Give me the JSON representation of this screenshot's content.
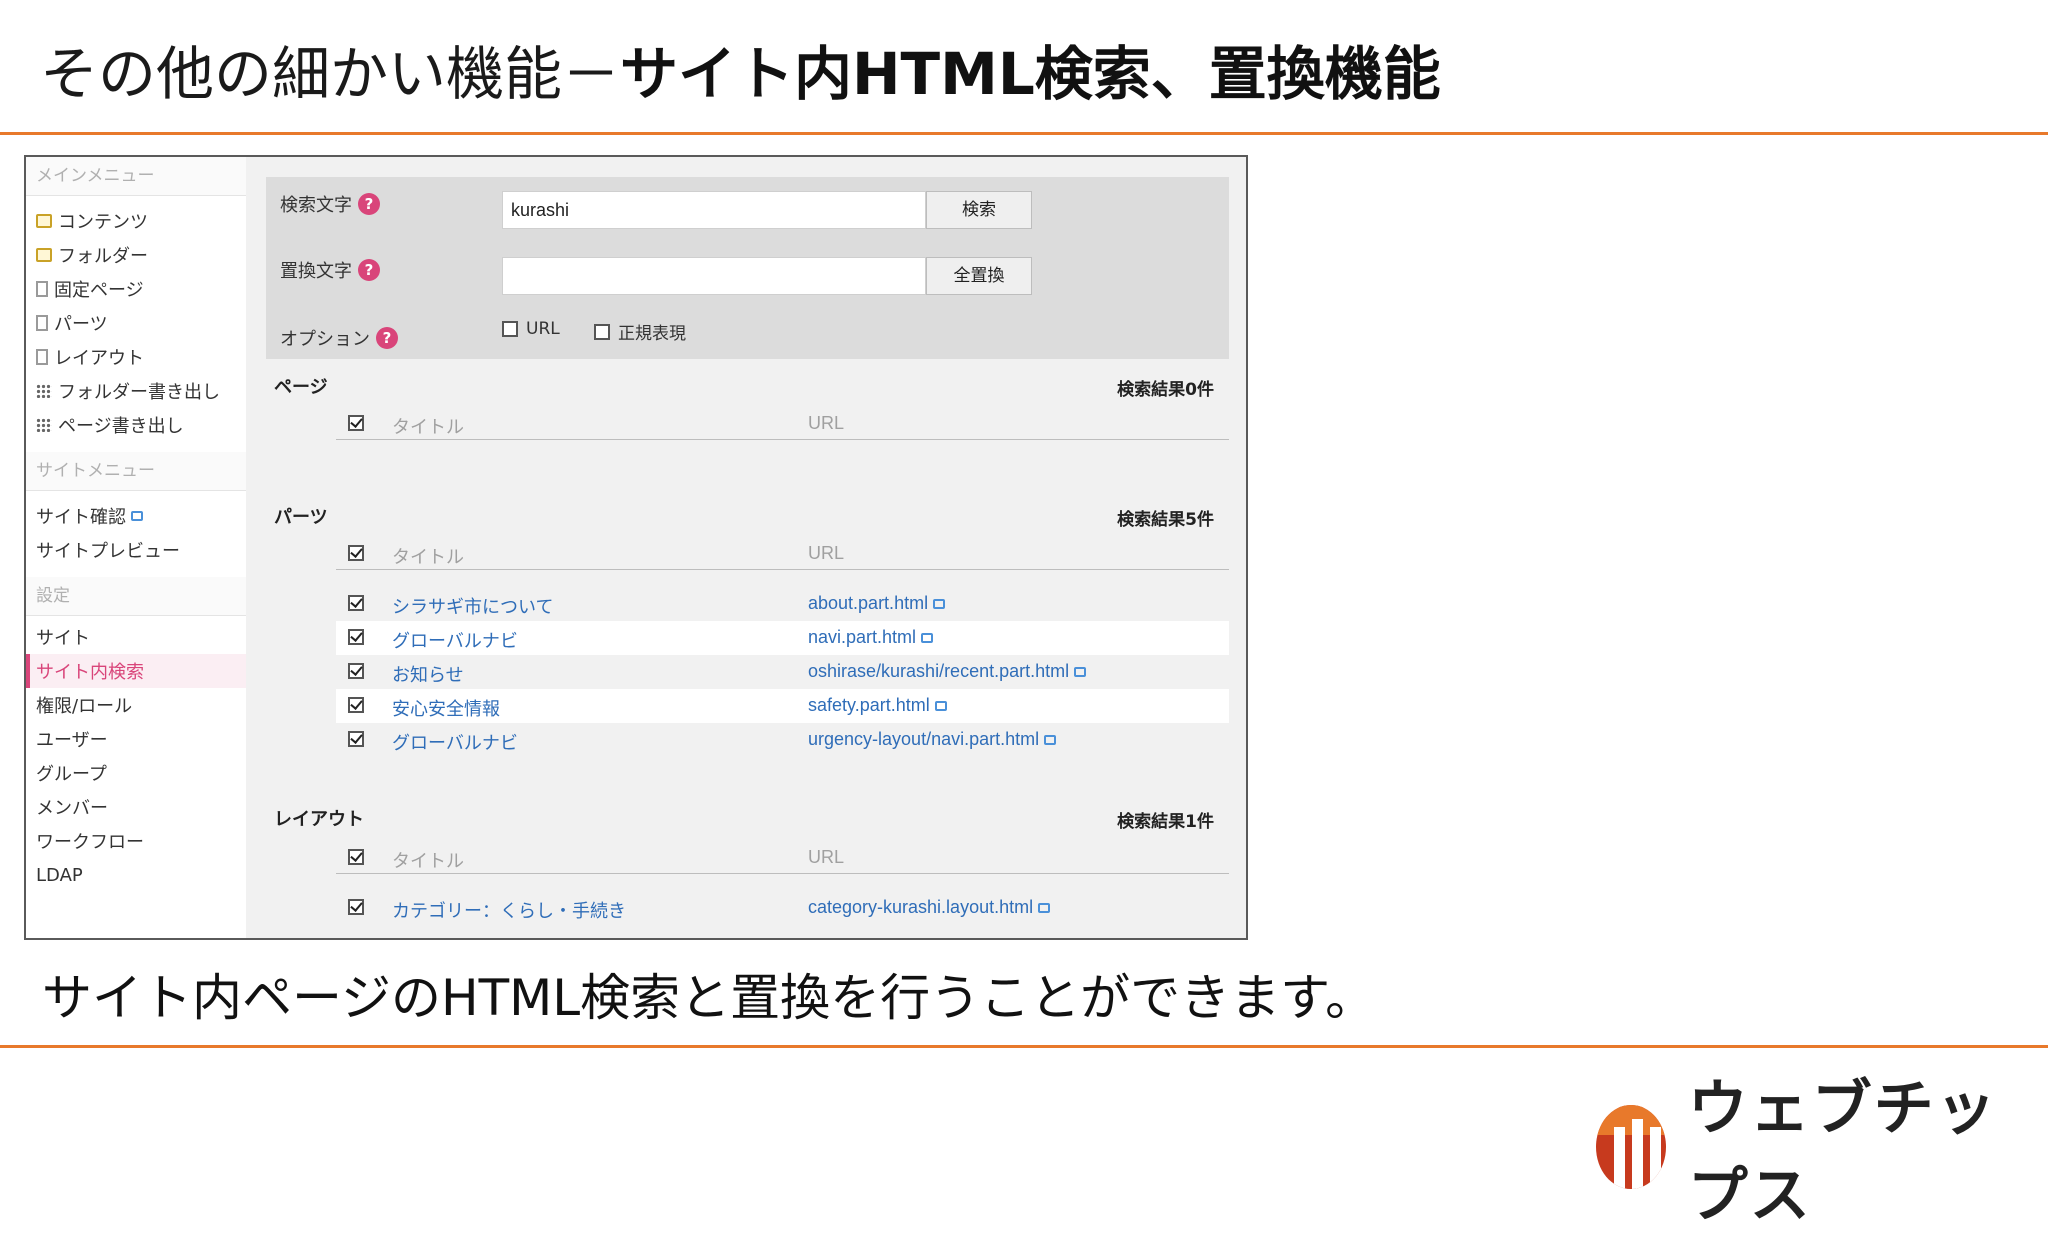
{
  "slide": {
    "title_light": "その他の細かい機能－",
    "title_bold": "サイト内HTML検索、置換機能",
    "subtitle": "サイト内ページのHTML検索と置換を行うことができます。",
    "logo_text": "ウェブチップス"
  },
  "sidebar": {
    "main_menu_heading": "メインメニュー",
    "main_items": [
      {
        "label": "コンテンツ",
        "icon": "folder-icon"
      },
      {
        "label": "フォルダー",
        "icon": "folder-icon"
      },
      {
        "label": "固定ページ",
        "icon": "page-icon"
      },
      {
        "label": "パーツ",
        "icon": "page-icon"
      },
      {
        "label": "レイアウト",
        "icon": "page-icon"
      },
      {
        "label": "フォルダー書き出し",
        "icon": "grid-icon"
      },
      {
        "label": "ページ書き出し",
        "icon": "grid-icon"
      }
    ],
    "site_menu_heading": "サイトメニュー",
    "site_items": [
      {
        "label": "サイト確認"
      },
      {
        "label": "サイトプレビュー"
      }
    ],
    "settings_heading": "設定",
    "settings_items": [
      {
        "label": "サイト"
      },
      {
        "label": "サイト内検索",
        "active": true
      },
      {
        "label": "権限/ロール"
      },
      {
        "label": "ユーザー"
      },
      {
        "label": "グループ"
      },
      {
        "label": "メンバー"
      },
      {
        "label": "ワークフロー"
      },
      {
        "label": "LDAP"
      }
    ]
  },
  "form": {
    "search_label": "検索文字",
    "search_value": "kurashi",
    "search_button": "検索",
    "replace_label": "置換文字",
    "replace_value": "",
    "replace_all_button": "全置換",
    "options_label": "オプション",
    "option_url": "URL",
    "option_regex": "正規表現",
    "help_glyph": "?"
  },
  "results": {
    "col_title": "タイトル",
    "col_url": "URL",
    "pages": {
      "heading": "ページ",
      "count": "検索結果0件",
      "rows": []
    },
    "parts": {
      "heading": "パーツ",
      "count": "検索結果5件",
      "rows": [
        {
          "title": "シラサギ市について",
          "url": "about.part.html"
        },
        {
          "title": "グローバルナビ",
          "url": "navi.part.html"
        },
        {
          "title": "お知らせ",
          "url": "oshirase/kurashi/recent.part.html"
        },
        {
          "title": "安心安全情報",
          "url": "safety.part.html"
        },
        {
          "title": "グローバルナビ",
          "url": "urgency-layout/navi.part.html"
        }
      ]
    },
    "layouts": {
      "heading": "レイアウト",
      "count": "検索結果1件",
      "rows": [
        {
          "title": "カテゴリー：くらし・手続き",
          "url": "category-kurashi.layout.html"
        }
      ]
    }
  },
  "colors": {
    "accent_orange": "#e8792b",
    "active_pink": "#d9457a",
    "link_blue": "#2f6db8"
  }
}
